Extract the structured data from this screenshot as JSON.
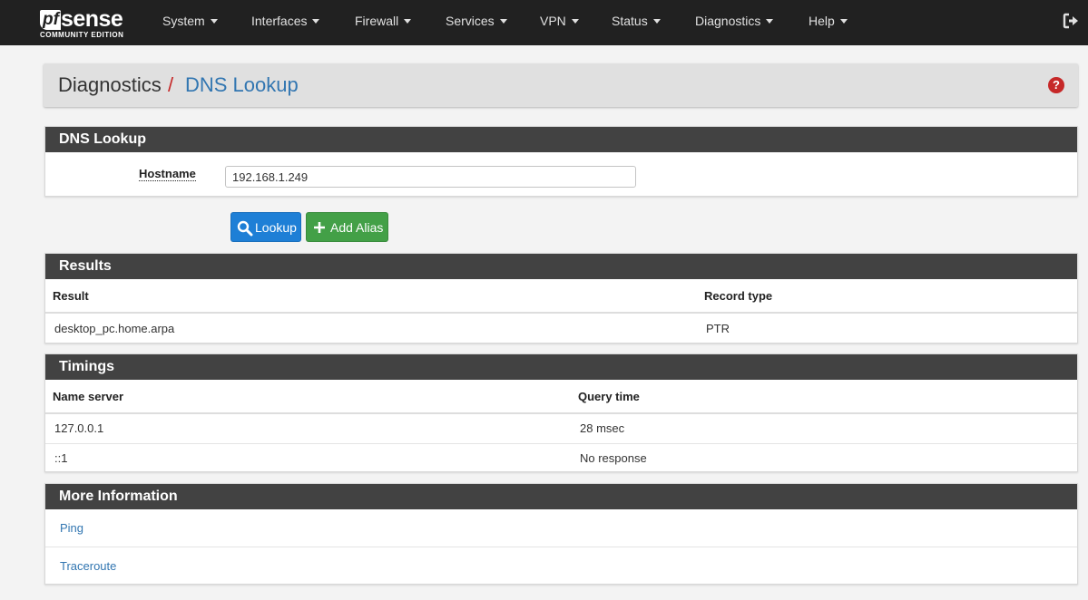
{
  "brand": {
    "logo_main": "pf",
    "logo_sense": "sense",
    "logo_sub": "COMMUNITY EDITION"
  },
  "nav": {
    "items": [
      {
        "label": "System"
      },
      {
        "label": "Interfaces"
      },
      {
        "label": "Firewall"
      },
      {
        "label": "Services"
      },
      {
        "label": "VPN"
      },
      {
        "label": "Status"
      },
      {
        "label": "Diagnostics"
      },
      {
        "label": "Help"
      }
    ],
    "logout_icon": "sign-out-icon"
  },
  "breadcrumb": {
    "root": "Diagnostics",
    "separator": "/",
    "current": "DNS Lookup",
    "help_icon": "question-circle-icon",
    "help_symbol": "?"
  },
  "dns_lookup_panel": {
    "title": "DNS Lookup",
    "hostname_label": "Hostname",
    "hostname_value": "192.168.1.249"
  },
  "buttons": {
    "lookup": "Lookup",
    "add_alias": "Add Alias"
  },
  "results_panel": {
    "title": "Results",
    "columns": [
      "Result",
      "Record type"
    ],
    "rows": [
      [
        "desktop_pc.home.arpa",
        "PTR"
      ]
    ]
  },
  "timings_panel": {
    "title": "Timings",
    "columns": [
      "Name server",
      "Query time"
    ],
    "rows": [
      [
        "127.0.0.1",
        "28 msec"
      ],
      [
        "::1",
        "No response"
      ]
    ]
  },
  "more_info_panel": {
    "title": "More Information",
    "links": [
      "Ping",
      "Traceroute"
    ]
  },
  "colors": {
    "navbar": "#212121",
    "panel_heading": "#424242",
    "link": "#3276b1",
    "primary": "#1e7fd6",
    "success": "#43a047",
    "danger": "#c62828"
  }
}
